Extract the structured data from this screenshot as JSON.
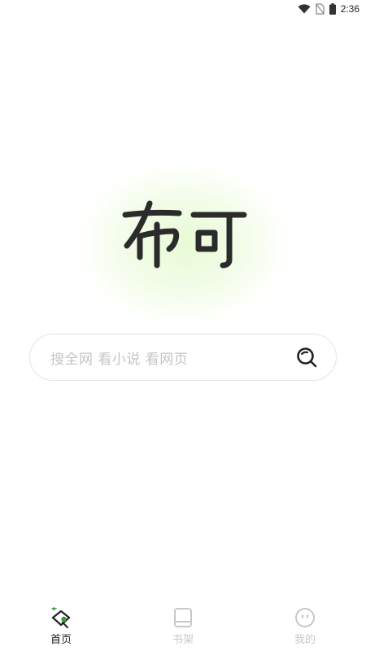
{
  "status_bar": {
    "time": "2:36"
  },
  "logo": {
    "text": "布可"
  },
  "search": {
    "placeholder": "搜全网 看小说 看网页"
  },
  "bottom_nav": {
    "items": [
      {
        "label": "首页",
        "icon": "home-icon",
        "active": true
      },
      {
        "label": "书架",
        "icon": "bookshelf-icon",
        "active": false
      },
      {
        "label": "我的",
        "icon": "profile-icon",
        "active": false
      }
    ]
  },
  "colors": {
    "accent": "#3a9a3a",
    "glow": "#e6fad2",
    "active_text": "#222222",
    "inactive_text": "#c8c8c8",
    "placeholder": "#c4c4c4"
  }
}
